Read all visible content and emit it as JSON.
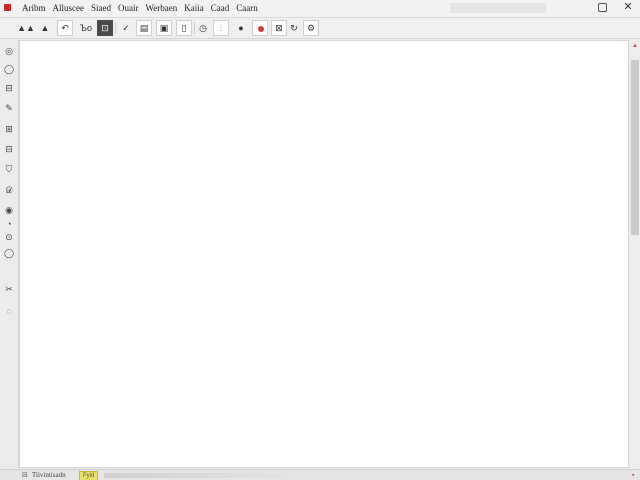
{
  "menu": {
    "items": [
      {
        "label": "Aribm"
      },
      {
        "label": "Alluscee"
      },
      {
        "label": "Siaed"
      },
      {
        "label": "Ouair"
      },
      {
        "label": "Werbaen"
      },
      {
        "label": "Kaiia"
      },
      {
        "label": "Caad"
      },
      {
        "label": "Caarn"
      }
    ]
  },
  "window_controls": {
    "close_glyph": "✕",
    "restore_icon": "restore-icon"
  },
  "toolbar": {
    "buttons": [
      {
        "icon": "shapes-icon",
        "glyph": "▲▲"
      },
      {
        "icon": "triangle-icon",
        "glyph": "▲"
      },
      {
        "icon": "undo-icon",
        "glyph": "↶"
      },
      {
        "icon": "bold-tool-icon",
        "glyph": "Ъo"
      },
      {
        "icon": "selected-tool-icon",
        "glyph": "⊡"
      },
      {
        "icon": "check-icon",
        "glyph": "✓"
      },
      {
        "icon": "panel-icon",
        "glyph": "▤"
      },
      {
        "icon": "image-icon",
        "glyph": "▣"
      },
      {
        "icon": "page-icon",
        "glyph": "▯"
      },
      {
        "icon": "clock-icon",
        "glyph": "◷"
      },
      {
        "icon": "chart-icon",
        "glyph": "⫶"
      },
      {
        "icon": "comment-icon",
        "glyph": "●"
      },
      {
        "icon": "record-icon",
        "glyph": ""
      },
      {
        "icon": "box-x-icon",
        "glyph": "⊠"
      },
      {
        "icon": "refresh-icon",
        "glyph": "↻"
      },
      {
        "icon": "settings-icon",
        "glyph": "⚙"
      }
    ]
  },
  "palette": {
    "tools": [
      {
        "icon": "cursor-icon",
        "glyph": "◎"
      },
      {
        "icon": "circle-icon",
        "glyph": "◯"
      },
      {
        "icon": "stamp-icon",
        "glyph": "⊟"
      },
      {
        "icon": "brush-icon",
        "glyph": "✎"
      },
      {
        "icon": "eraser-icon",
        "glyph": "⊞"
      },
      {
        "icon": "layer-icon",
        "glyph": "⊟"
      },
      {
        "icon": "shield-icon",
        "glyph": "⛉"
      },
      {
        "icon": "pen-icon",
        "glyph": "𝒟"
      },
      {
        "icon": "globe-icon",
        "glyph": "◉"
      },
      {
        "icon": "drop-icon",
        "glyph": "◔"
      },
      {
        "icon": "eye-icon",
        "glyph": "⊙"
      },
      {
        "icon": "lens-icon",
        "glyph": "◯"
      },
      {
        "icon": "wand-icon",
        "glyph": "✂"
      },
      {
        "icon": "speech-icon",
        "glyph": "◌"
      }
    ]
  },
  "status": {
    "icon_glyph": "⊟",
    "text": "Tiivintisadn",
    "badge": "Fyid",
    "end_glyph": "▪"
  },
  "colors": {
    "accent_red": "#d8232a",
    "badge_yellow": "#e9e26a",
    "canvas": "#ffffff"
  }
}
